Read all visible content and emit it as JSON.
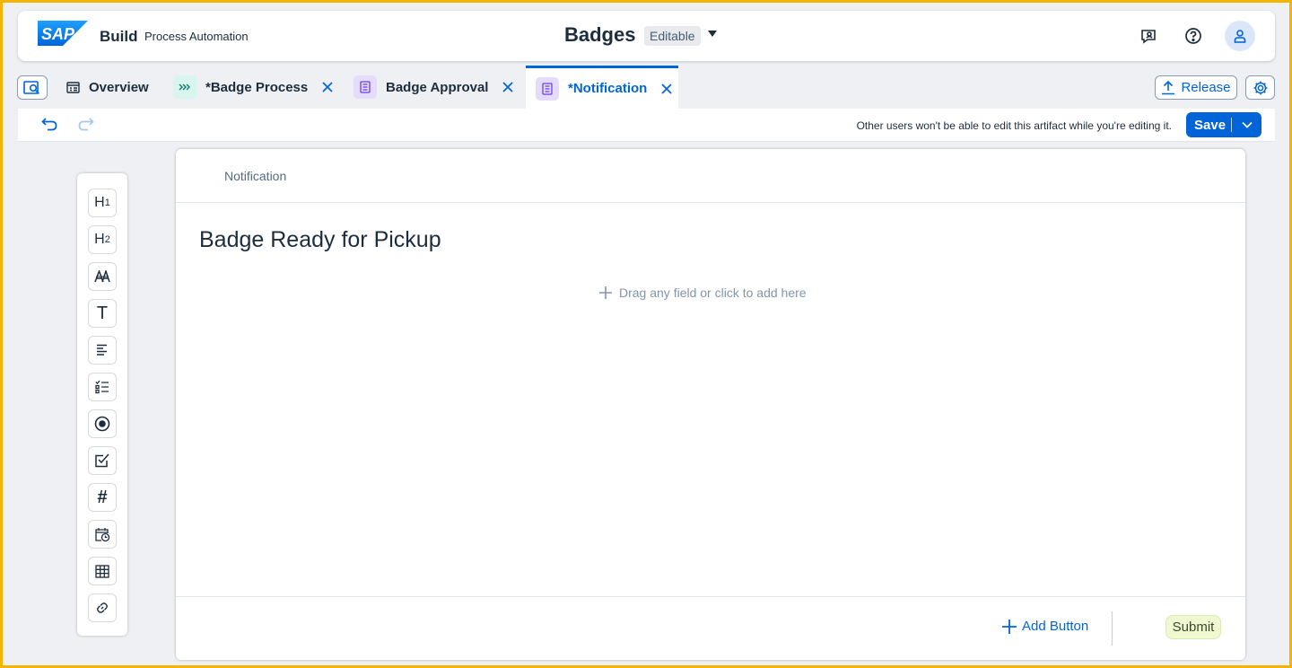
{
  "shell": {
    "logo_text": "SAP",
    "brand": "Build",
    "product": "Process Automation",
    "title": "Badges",
    "status": "Editable",
    "icons": [
      "feedback-icon",
      "help-icon",
      "user-avatar-icon"
    ]
  },
  "tabs": [
    {
      "label": "Overview",
      "icon": "overview-icon",
      "closable": false,
      "active": false
    },
    {
      "label": "*Badge Process",
      "icon": "process-icon",
      "closable": true,
      "active": false
    },
    {
      "label": "Badge Approval",
      "icon": "form-icon",
      "closable": true,
      "active": false
    },
    {
      "label": "*Notification",
      "icon": "form-icon",
      "closable": true,
      "active": true
    }
  ],
  "actions": {
    "release": "Release"
  },
  "toolbar": {
    "lock_message": "Other users won't be able to edit this artifact while you're editing it.",
    "save": "Save"
  },
  "palette": {
    "items": [
      "heading-1",
      "heading-2",
      "text-style",
      "text",
      "paragraph",
      "checklist",
      "radio",
      "checkbox",
      "number",
      "date-time",
      "table",
      "link"
    ],
    "h1_label": "H",
    "h1_sub": "1",
    "h2_label": "H",
    "h2_sub": "2",
    "text_label": "T",
    "number_label": "#"
  },
  "canvas": {
    "header": "Notification",
    "title": "Badge Ready for Pickup",
    "drop_hint": "Drag any field or click to add here",
    "add_button": "Add Button",
    "submit": "Submit"
  },
  "colors": {
    "accent": "#0064d9",
    "frame": "#f5b400",
    "background": "#eef0f3",
    "submit_bg": "#eff8d0"
  }
}
